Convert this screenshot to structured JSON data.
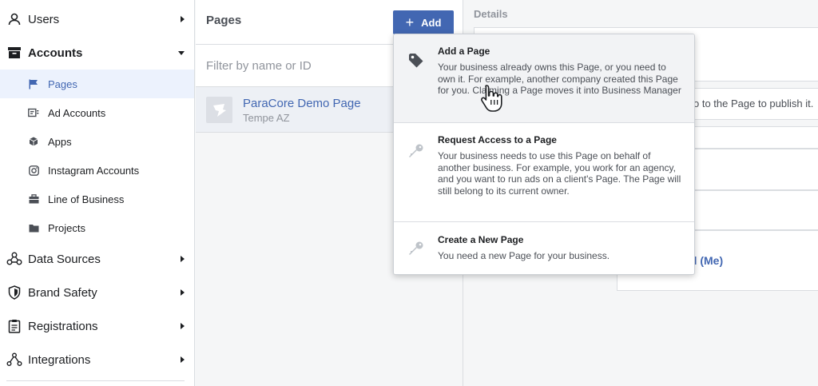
{
  "sidebar": {
    "items": [
      {
        "label": "Users",
        "icon": "user-icon"
      },
      {
        "label": "Accounts",
        "icon": "archive-box-icon"
      },
      {
        "label": "Data Sources",
        "icon": "network-icon"
      },
      {
        "label": "Brand Safety",
        "icon": "shield-icon"
      },
      {
        "label": "Registrations",
        "icon": "clipboard-icon"
      },
      {
        "label": "Integrations",
        "icon": "graph-icon"
      }
    ],
    "accounts_sub": [
      {
        "label": "Pages",
        "icon": "flag-icon"
      },
      {
        "label": "Ad Accounts",
        "icon": "ad-card-icon"
      },
      {
        "label": "Apps",
        "icon": "cube-icon"
      },
      {
        "label": "Instagram Accounts",
        "icon": "instagram-icon"
      },
      {
        "label": "Line of Business",
        "icon": "briefcase-icon"
      },
      {
        "label": "Projects",
        "icon": "folder-icon"
      }
    ]
  },
  "pages_panel": {
    "title": "Pages",
    "add_label": "Add",
    "filter_placeholder": "Filter by name or ID",
    "items": [
      {
        "name": "ParaCore Demo Page",
        "location": "Tempe AZ"
      }
    ]
  },
  "details": {
    "label": "Details",
    "partial_text": "o to the Page to publish it.",
    "partial_link": "ld (Me)"
  },
  "add_menu": {
    "items": [
      {
        "title": "Add a Page",
        "icon": "tag-icon",
        "desc": "Your business already owns this Page, or you need to own it. For example, another company created this Page for you. Claiming a Page moves it into Business Manager"
      },
      {
        "title": "Request Access to a Page",
        "icon": "key-icon",
        "desc": "Your business needs to use this Page on behalf of another business. For example, you work for an agency, and you want to run ads on a client's Page. The Page will still belong to its current owner."
      },
      {
        "title": "Create a New Page",
        "icon": "key-icon",
        "desc": "You need a new Page for your business."
      }
    ]
  },
  "colors": {
    "accent": "#4267b2",
    "active_bg": "#ecf2fd",
    "text": "#1c1e21",
    "muted": "#90949c"
  }
}
